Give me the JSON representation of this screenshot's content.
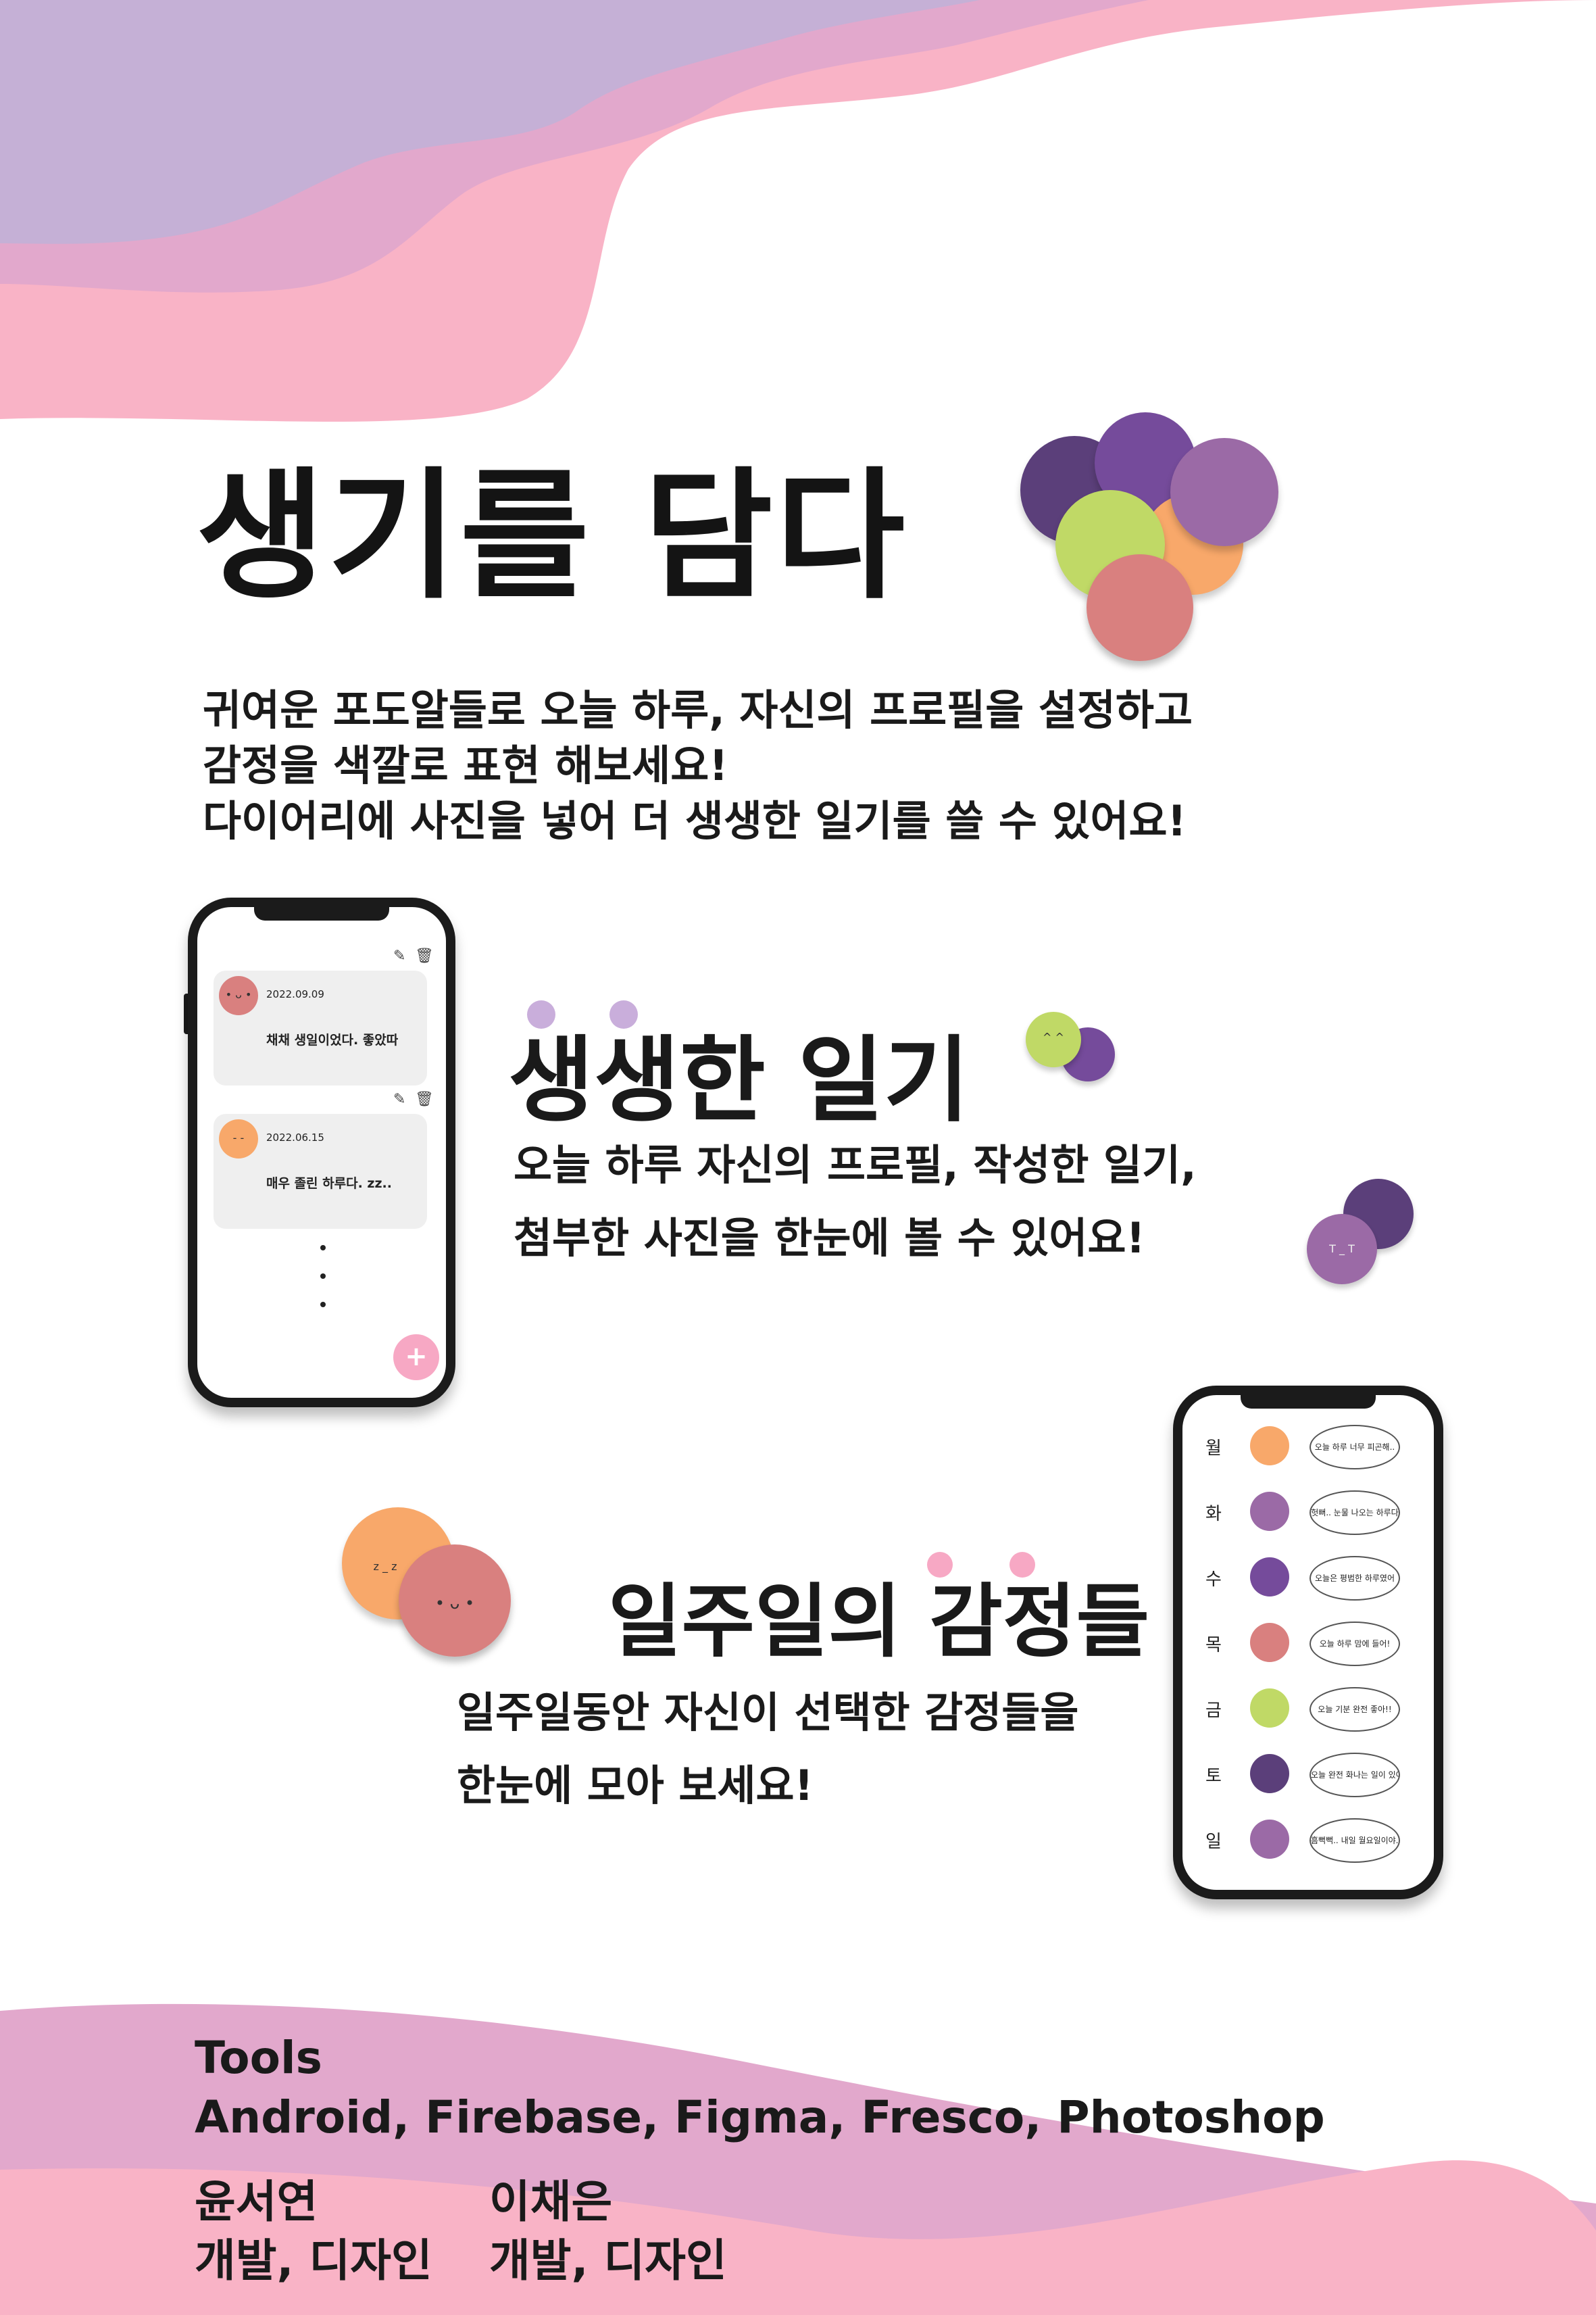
{
  "colors": {
    "lavender": "#c5b0d6",
    "mauve": "#e2a8cc",
    "pink": "#f9b3c6",
    "dark_text": "#141414",
    "grape_dark": "#5b3f7a",
    "grape_purple": "#754b9b",
    "grape_violet": "#9b6aa6",
    "grape_lime": "#c0d966",
    "grape_orange": "#f8a86a",
    "grape_rose": "#d9807f",
    "dot_lavender": "#c9aedb",
    "dot_pink": "#f7a8c4"
  },
  "header": {
    "title": "생기를 담다",
    "intro_lines": [
      "귀여운 포도알들로 오늘 하루, 자신의 프로필을 설정하고",
      "감정을 색깔로 표현 해보세요!",
      "다이어리에 사진을 넣어 더 생생한 일기를 쓸 수 있어요!"
    ]
  },
  "section_diary": {
    "title": "생생한 일기",
    "desc_lines": [
      "오늘 하루 자신의 프로필, 작성한 일기,",
      "첨부한 사진을 한눈에 볼 수 있어요!"
    ],
    "deco_faces": [
      "^ ^",
      "T _ T"
    ],
    "phone": {
      "entries": [
        {
          "date": "2022.09.09",
          "text": "채채 생일이었다. 좋았따",
          "face": "• ᴗ •"
        },
        {
          "date": "2022.06.15",
          "text": "매우 졸린 하루다. zz..",
          "face": "- -"
        }
      ],
      "edit_icon": "edit-icon",
      "delete_icon": "trash-icon",
      "add_button": "+"
    }
  },
  "section_week": {
    "title": "일주일의 감정들",
    "desc_lines": [
      "일주일동안 자신이 선택한 감정들을",
      "한눈에 모아 보세요!"
    ],
    "deco_faces": [
      "z _ z",
      "• ᴗ •"
    ],
    "days": [
      {
        "day": "월",
        "color": "#f8a86a",
        "text": "오늘 하루 너무 피곤해.."
      },
      {
        "day": "화",
        "color": "#9b6aa6",
        "text": "헛뻐.. 눈물 나오는 하루다"
      },
      {
        "day": "수",
        "color": "#754b9b",
        "text": "오늘은 평범한 하루였어"
      },
      {
        "day": "목",
        "color": "#d9807f",
        "text": "오늘 하루 맘에 들어!"
      },
      {
        "day": "금",
        "color": "#c0d966",
        "text": "오늘 기분 완전 좋아!!"
      },
      {
        "day": "토",
        "color": "#5b3f7a",
        "text": "오늘 완전 화나는 일이 있어!"
      },
      {
        "day": "일",
        "color": "#9b6aa6",
        "text": "흠뻑뻑.. 내일 월요일이야.."
      }
    ]
  },
  "footer": {
    "tools_label": "Tools",
    "tools_list": "Android, Firebase, Figma, Fresco, Photoshop",
    "members": [
      {
        "name": "윤서연",
        "role": "개발, 디자인"
      },
      {
        "name": "이채은",
        "role": "개발, 디자인"
      }
    ]
  }
}
